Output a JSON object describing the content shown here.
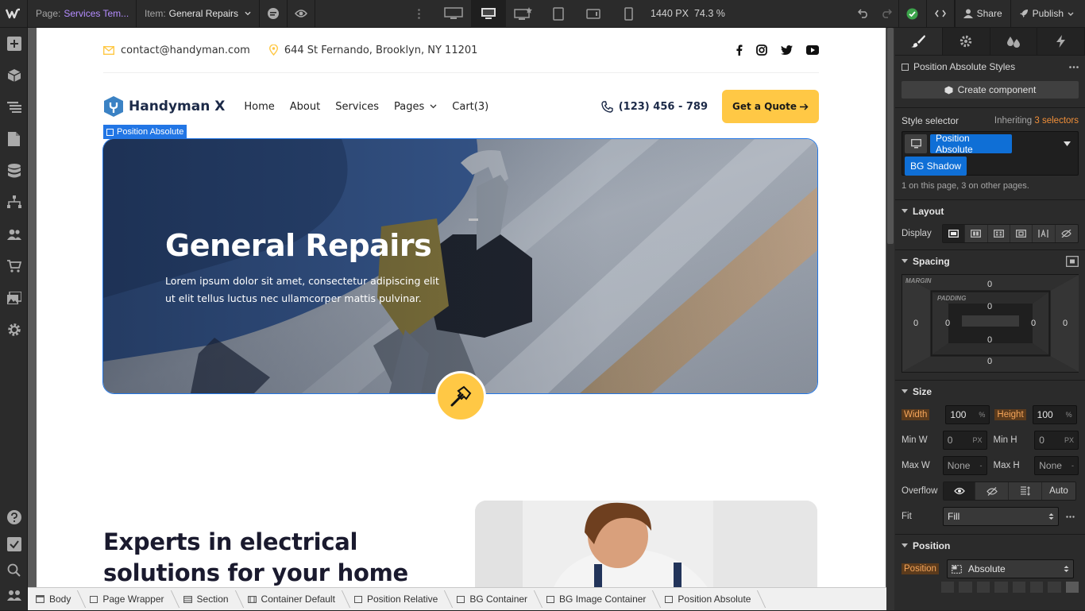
{
  "topbar": {
    "page_key": "Page:",
    "page_value": "Services Tem...",
    "item_key": "Item:",
    "item_value": "General Repairs",
    "breakpoint_width": "1440 PX",
    "zoom": "74.3 %",
    "share_label": "Share",
    "publish_label": "Publish"
  },
  "site": {
    "email": "contact@handyman.com",
    "address": "644 St Fernando, Brooklyn, NY 11201",
    "brand": "Handyman X",
    "menu": [
      "Home",
      "About",
      "Services",
      "Pages",
      "Cart(3)"
    ],
    "phone": "(123) 456 - 789",
    "quote_label": "Get a Quote",
    "selection_label": "Position Absolute",
    "hero_title": "General Repairs",
    "hero_text": "Lorem ipsum dolor sit amet, consectetur adipiscing elit ut elit tellus luctus nec ullamcorper mattis pulvinar.",
    "section_title_1": "Experts in electrical",
    "section_title_2": "solutions for your home"
  },
  "panel": {
    "element_label": "Position Absolute Styles",
    "create_component": "Create component",
    "style_selector": "Style selector",
    "inheriting_prefix": "Inheriting",
    "inheriting_count": "3 selectors",
    "chip_1": "Position Absolute",
    "chip_2": "BG Shadow",
    "usage_note": "1 on this page, 3 on other pages.",
    "layout": {
      "title": "Layout",
      "display_label": "Display"
    },
    "spacing": {
      "title": "Spacing",
      "margin_label": "MARGIN",
      "padding_label": "PADDING",
      "margin_top": "0",
      "margin_right": "0",
      "margin_bottom": "0",
      "margin_left": "0",
      "padding_top": "0",
      "padding_right": "0",
      "padding_bottom": "0",
      "padding_left": "0"
    },
    "size": {
      "title": "Size",
      "width_label": "Width",
      "width_value": "100",
      "width_unit": "%",
      "height_label": "Height",
      "height_value": "100",
      "height_unit": "%",
      "minw_label": "Min W",
      "minw_value": "0",
      "minw_unit": "PX",
      "minh_label": "Min H",
      "minh_value": "0",
      "minh_unit": "PX",
      "maxw_label": "Max W",
      "maxw_value": "None",
      "maxw_unit": "-",
      "maxh_label": "Max H",
      "maxh_value": "None",
      "maxh_unit": "-"
    },
    "overflow_label": "Overflow",
    "overflow_auto": "Auto",
    "fit_label": "Fit",
    "fit_value": "Fill",
    "position": {
      "title": "Position",
      "label": "Position",
      "value": "Absolute"
    }
  },
  "breadcrumbs": [
    "Body",
    "Page Wrapper",
    "Section",
    "Container Default",
    "Position Relative",
    "BG Container",
    "BG Image Container",
    "Position Absolute"
  ],
  "colors": {
    "accent": "#ffc845",
    "selection": "#2276e5",
    "panel_bg": "#2b2b2b",
    "brand_blue": "#3b82c4"
  }
}
